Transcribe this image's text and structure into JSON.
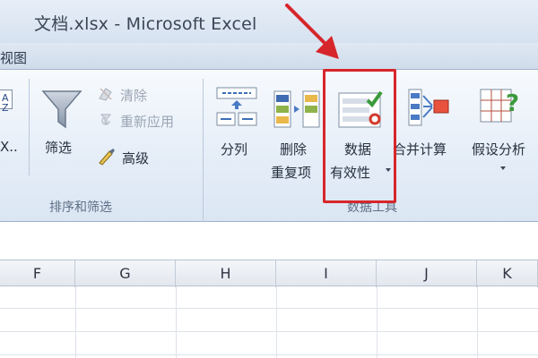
{
  "window": {
    "title": "文档.xlsx - Microsoft Excel"
  },
  "tabs": {
    "view_label": "视图"
  },
  "ribbon": {
    "sort_partial_label": "X..",
    "filter_label": "筛选",
    "clear_label": "清除",
    "reapply_label": "重新应用",
    "advanced_label": "高级",
    "text_to_columns_label": "分列",
    "remove_duplicates_line1": "删除",
    "remove_duplicates_line2": "重复项",
    "data_validation_line1": "数据",
    "data_validation_line2": "有效性",
    "consolidate_label": "合并计算",
    "what_if_label": "假设分析",
    "group_sort_filter": "排序和筛选",
    "group_data_tools": "数据工具"
  },
  "sheet": {
    "columns": [
      "F",
      "G",
      "H",
      "I",
      "J",
      "K"
    ]
  },
  "colors": {
    "highlight": "#d7262b",
    "ribbon_bg": "#e6eef8"
  },
  "icons": [
    "filter-icon",
    "clear-icon",
    "reapply-icon",
    "advanced-icon",
    "text-to-columns-icon",
    "remove-duplicates-icon",
    "data-validation-icon",
    "consolidate-icon",
    "what-if-icon"
  ]
}
